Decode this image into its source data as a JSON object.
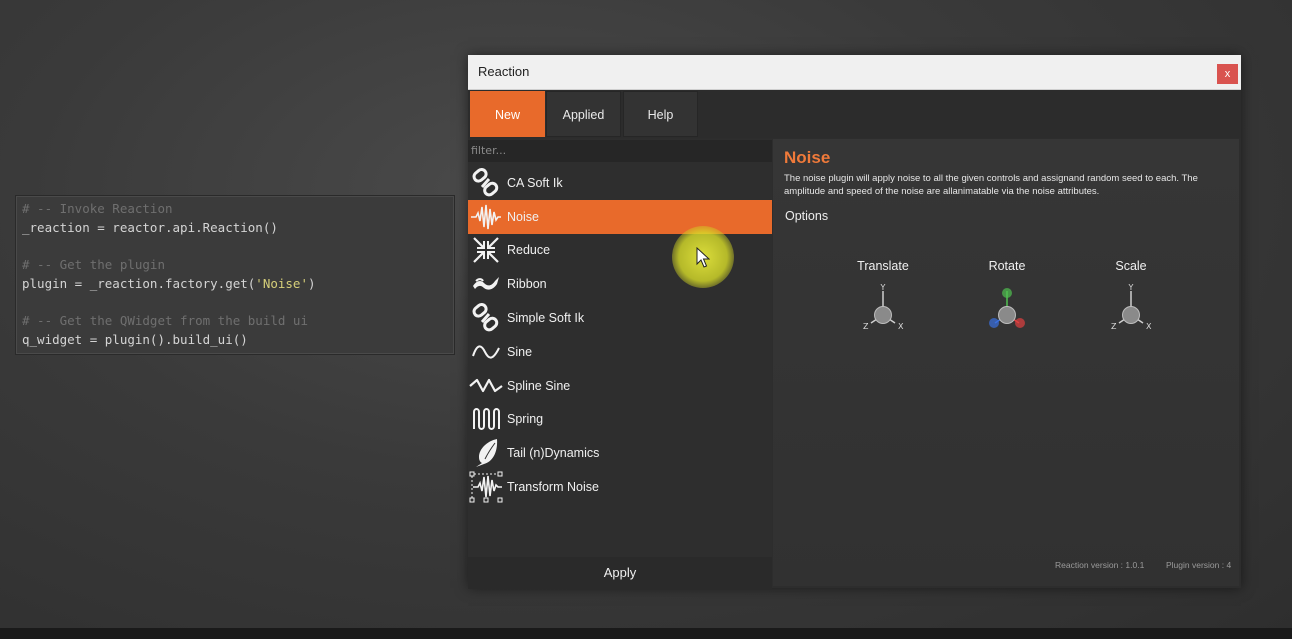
{
  "code": {
    "lines": [
      {
        "type": "comment",
        "text": "# -- Invoke Reaction"
      },
      {
        "type": "code",
        "text": "_reaction = reactor.api.Reaction()"
      },
      {
        "type": "gap"
      },
      {
        "type": "comment",
        "text": "# -- Get the plugin"
      },
      {
        "type": "code_str",
        "before": "plugin = _reaction.factory.get(",
        "str": "'Noise'",
        "after": ")"
      },
      {
        "type": "gap"
      },
      {
        "type": "comment",
        "text": "# -- Get the QWidget from the build ui"
      },
      {
        "type": "code",
        "text": "q_widget = plugin().build_ui()"
      }
    ]
  },
  "window": {
    "title": "Reaction",
    "close_label": "x",
    "tabs": [
      {
        "label": "New",
        "active": true
      },
      {
        "label": "Applied",
        "active": false
      },
      {
        "label": "Help",
        "active": false
      }
    ],
    "filter_placeholder": "filter...",
    "plugins": [
      {
        "label": "CA Soft Ik",
        "icon": "chain-link-icon",
        "selected": false
      },
      {
        "label": "Noise",
        "icon": "noise-waveform-icon",
        "selected": true
      },
      {
        "label": "Reduce",
        "icon": "reduce-arrows-icon",
        "selected": false
      },
      {
        "label": "Ribbon",
        "icon": "ribbon-icon",
        "selected": false
      },
      {
        "label": "Simple Soft Ik",
        "icon": "chain-link-icon",
        "selected": false
      },
      {
        "label": "Sine",
        "icon": "sine-wave-icon",
        "selected": false
      },
      {
        "label": "Spline Sine",
        "icon": "spline-sine-icon",
        "selected": false
      },
      {
        "label": "Spring",
        "icon": "spring-icon",
        "selected": false
      },
      {
        "label": "Tail (n)Dynamics",
        "icon": "tail-feather-icon",
        "selected": false
      },
      {
        "label": "Transform Noise",
        "icon": "transform-noise-icon",
        "selected": false
      }
    ],
    "apply_label": "Apply",
    "detail": {
      "title": "Noise",
      "description": "The noise plugin will apply noise to all the given controls and assignand random seed to each. The amplitude and speed of the noise are allanimatable via the noise attributes.",
      "options_label": "Options",
      "axes": [
        {
          "label": "Translate",
          "colored": false
        },
        {
          "label": "Rotate",
          "colored": true
        },
        {
          "label": "Scale",
          "colored": false
        }
      ],
      "axis_letters": {
        "x": "X",
        "y": "Y",
        "z": "Z"
      },
      "reaction_version": "Reaction version : 1.0.1",
      "plugin_version": "Plugin version : 4"
    }
  },
  "colors": {
    "accent": "#e86a2b",
    "title_orange": "#f07a3a",
    "axis_x": "#e04040",
    "axis_y": "#50c050",
    "axis_z": "#3a70e0"
  }
}
